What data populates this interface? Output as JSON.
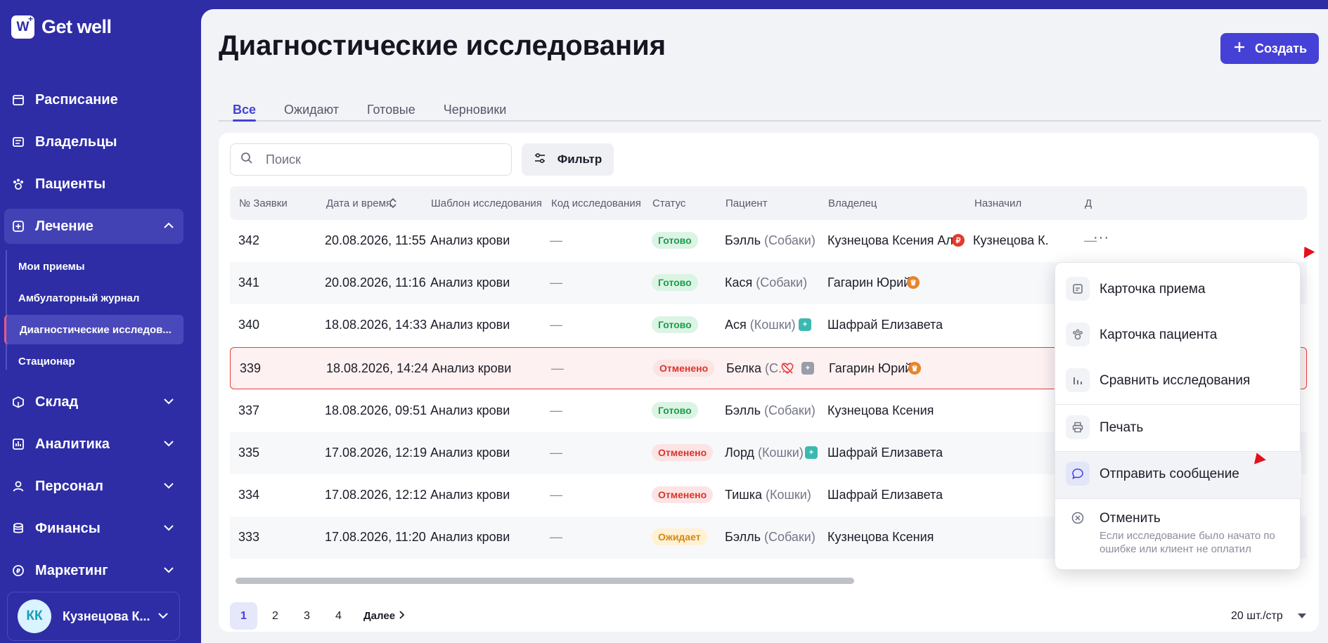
{
  "app": {
    "logo_text": "Get well"
  },
  "sidebar": {
    "items": [
      {
        "label": "Расписание",
        "icon": "calendar-icon"
      },
      {
        "label": "Владельцы",
        "icon": "owners-icon"
      },
      {
        "label": "Пациенты",
        "icon": "paw-icon"
      },
      {
        "label": "Лечение",
        "icon": "plus-square-icon"
      },
      {
        "label": "Склад",
        "icon": "box-icon"
      },
      {
        "label": "Аналитика",
        "icon": "chart-icon"
      },
      {
        "label": "Персонал",
        "icon": "user-icon"
      },
      {
        "label": "Финансы",
        "icon": "coins-icon"
      },
      {
        "label": "Маркетинг",
        "icon": "ruble-icon"
      }
    ],
    "subitems": [
      {
        "label": "Мои приемы"
      },
      {
        "label": "Амбулаторный журнал"
      },
      {
        "label": "Диагностические исследов..."
      },
      {
        "label": "Стационар"
      }
    ],
    "user": {
      "initials": "КК",
      "name": "Кузнецова К..."
    }
  },
  "page": {
    "title": "Диагностические исследования",
    "create_label": "Создать"
  },
  "tabs": [
    {
      "label": "Все"
    },
    {
      "label": "Ожидают"
    },
    {
      "label": "Готовые"
    },
    {
      "label": "Черновики"
    }
  ],
  "search": {
    "placeholder": "Поиск"
  },
  "filter": {
    "label": "Фильтр"
  },
  "table": {
    "columns": [
      "№ Заявки",
      "Дата и время",
      "Шаблон исследования",
      "Код исследования",
      "Статус",
      "Пациент",
      "Владелец",
      "Назначил",
      "Д"
    ],
    "rows": [
      {
        "id": "342",
        "date": "20.08.2026, 11:55",
        "template": "Анализ крови",
        "code": "—",
        "status": "Готово",
        "patient": "Бэлль",
        "species": "(Собаки)",
        "owner": "Кузнецова Ксения Ал...",
        "assigned": "Кузнецова К.",
        "dash": "—"
      },
      {
        "id": "341",
        "date": "20.08.2026, 11:16",
        "template": "Анализ крови",
        "code": "—",
        "status": "Готово",
        "patient": "Кася",
        "species": "(Собаки)",
        "owner": "Гагарин Юрий"
      },
      {
        "id": "340",
        "date": "18.08.2026, 14:33",
        "template": "Анализ крови",
        "code": "—",
        "status": "Готово",
        "patient": "Ася",
        "species": "(Кошки)",
        "owner": "Шафрай Елизавета"
      },
      {
        "id": "339",
        "date": "18.08.2026, 14:24",
        "template": "Анализ крови",
        "code": "—",
        "status": "Отменено",
        "patient": "Белка",
        "species": "(С...",
        "owner": "Гагарин Юрий"
      },
      {
        "id": "337",
        "date": "18.08.2026, 09:51",
        "template": "Анализ крови",
        "code": "—",
        "status": "Готово",
        "patient": "Бэлль",
        "species": "(Собаки)",
        "owner": "Кузнецова Ксения"
      },
      {
        "id": "335",
        "date": "17.08.2026, 12:19",
        "template": "Анализ крови",
        "code": "—",
        "status": "Отменено",
        "patient": "Лорд",
        "species": "(Кошки)",
        "owner": "Шафрай Елизавета"
      },
      {
        "id": "334",
        "date": "17.08.2026, 12:12",
        "template": "Анализ крови",
        "code": "—",
        "status": "Отменено",
        "patient": "Тишка",
        "species": "(Кошки)",
        "owner": "Шафрай Елизавета"
      },
      {
        "id": "333",
        "date": "17.08.2026, 11:20",
        "template": "Анализ крови",
        "code": "—",
        "status": "Ожидает",
        "patient": "Бэлль",
        "species": "(Собаки)",
        "owner": "Кузнецова Ксения"
      }
    ]
  },
  "pagination": {
    "pages": [
      "1",
      "2",
      "3",
      "4"
    ],
    "next_label": "Далее",
    "per_page": "20 шт./стр"
  },
  "menu": {
    "items": [
      {
        "label": "Карточка приема",
        "icon": "card-icon"
      },
      {
        "label": "Карточка пациента",
        "icon": "paw-icon"
      },
      {
        "label": "Сравнить исследования",
        "icon": "bar-chart-icon"
      },
      {
        "label": "Печать",
        "icon": "printer-icon"
      },
      {
        "label": "Отправить сообщение",
        "icon": "message-icon"
      },
      {
        "label": "Отменить",
        "icon": "cancel-circle-icon",
        "description": "Если исследование было начато по ошибке или клиент не оплатил"
      }
    ]
  },
  "colors": {
    "sidebar": "#2e2da6",
    "accent": "#4541d6",
    "ok": "#1a9c4a",
    "cancel": "#d9342b",
    "wait": "#d48810",
    "highlight_border": "#e63e3e"
  }
}
